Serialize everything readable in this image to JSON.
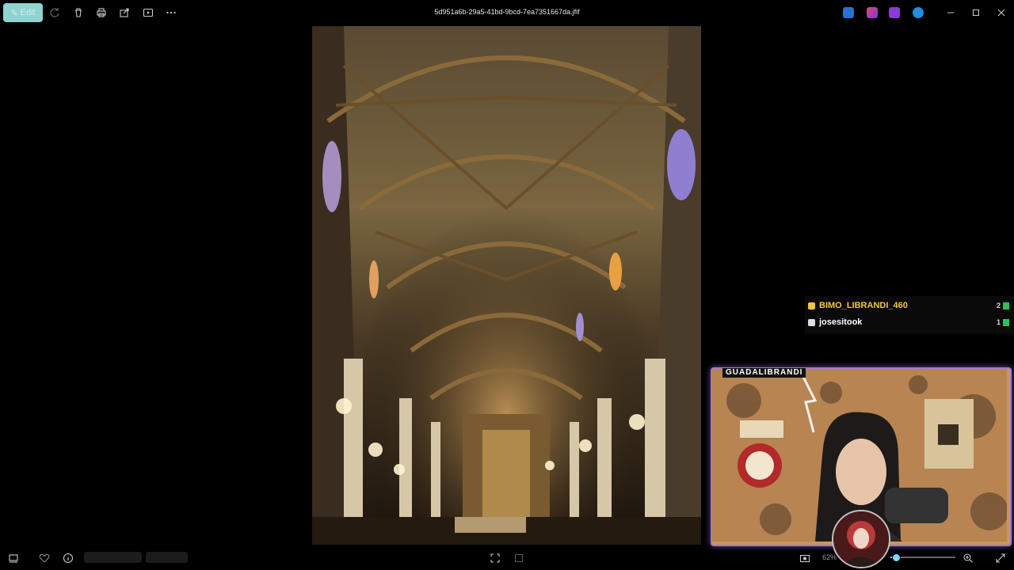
{
  "toolbar": {
    "edit_label": "Edit",
    "file_name": "5d951a6b-29a5-41bd-9bcd-7ea7351667da.jfif"
  },
  "chat": {
    "rows": [
      {
        "user": "BIMO_LIBRANDI_460",
        "count": "2",
        "color": "#f6c343"
      },
      {
        "user": "josesitook",
        "count": "1",
        "color": "#ffffff"
      }
    ]
  },
  "webcam": {
    "channel_name": "GUADALIBRANDI"
  },
  "bottombar": {
    "zoom": "62%"
  },
  "icons": [
    "pencil-icon",
    "rotate-icon",
    "delete-icon",
    "print-icon",
    "share-icon",
    "slideshow-icon",
    "more-icon",
    "minimize-icon",
    "maximize-icon",
    "close-icon",
    "filmstrip-icon",
    "favorite-icon",
    "info-icon",
    "fit-icon",
    "screenshot-icon",
    "zoom-in-icon",
    "fullscreen-icon"
  ]
}
